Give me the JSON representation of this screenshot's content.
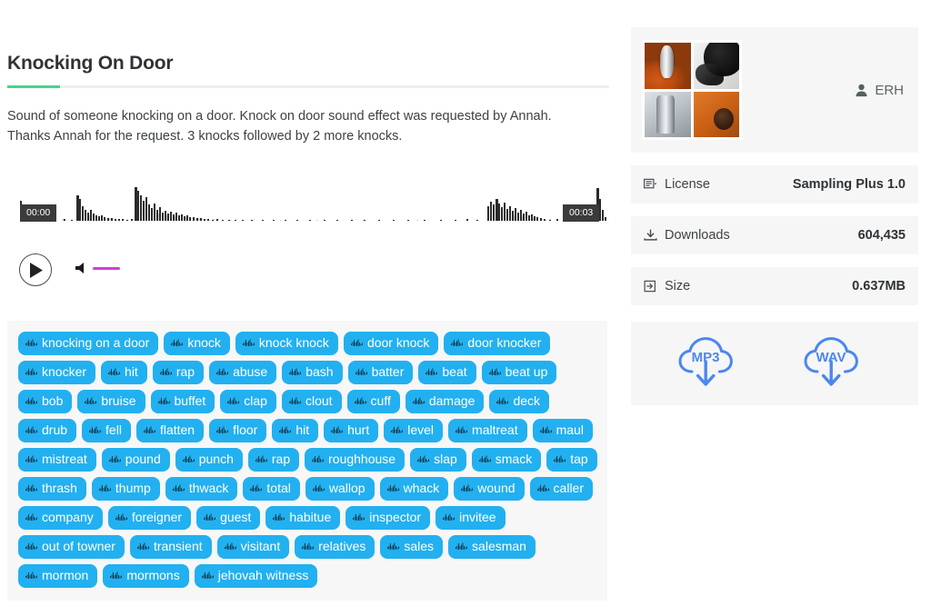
{
  "sound": {
    "title": "Knocking On Door",
    "description": "Sound of someone knocking on a door. Knock on door sound effect was requested by Annah. Thanks Annah for the request. 3 knocks followed by 2 more knocks."
  },
  "player": {
    "time_start": "00:00",
    "time_end": "00:03",
    "play_icon": "play-icon",
    "volume_icon": "speaker-icon",
    "volume_color": "#cf3fd6",
    "waveform_color": "#2b2b2b"
  },
  "author": {
    "name": "ERH",
    "icon": "user-icon",
    "avatar_tiles": [
      "microphone-orange",
      "woman-headphones",
      "microphone-gray",
      "vinyl-record"
    ]
  },
  "meta": [
    {
      "icon": "license-icon",
      "label": "License",
      "value": "Sampling Plus 1.0"
    },
    {
      "icon": "download-icon",
      "label": "Downloads",
      "value": "604,435"
    },
    {
      "icon": "size-icon",
      "label": "Size",
      "value": "0.637MB"
    }
  ],
  "downloads": [
    {
      "label": "MP3",
      "icon": "cloud-download-icon"
    },
    {
      "label": "WAV",
      "icon": "cloud-download-icon"
    }
  ],
  "colors": {
    "accent_green": "#4bd28a",
    "tag_blue": "#22b0f0",
    "download_blue": "#4a87f0",
    "panel_bg": "#f6f6f6",
    "tagbox_bg": "#f7f7f7"
  },
  "tags": [
    "knocking on a door",
    "knock",
    "knock knock",
    "door knock",
    "door knocker",
    "knocker",
    "hit",
    "rap",
    "abuse",
    "bash",
    "batter",
    "beat",
    "beat up",
    "bob",
    "bruise",
    "buffet",
    "clap",
    "clout",
    "cuff",
    "damage",
    "deck",
    "drub",
    "fell",
    "flatten",
    "floor",
    "hit",
    "hurt",
    "level",
    "maltreat",
    "maul",
    "mistreat",
    "pound",
    "punch",
    "rap",
    "roughhouse",
    "slap",
    "smack",
    "tap",
    "thrash",
    "thump",
    "thwack",
    "total",
    "wallop",
    "whack",
    "wound",
    "caller",
    "company",
    "foreigner",
    "guest",
    "habitue",
    "inspector",
    "invitee",
    "out of towner",
    "transient",
    "visitant",
    "relatives",
    "sales",
    "salesman",
    "mormon",
    "mormons",
    "jehovah witness"
  ]
}
